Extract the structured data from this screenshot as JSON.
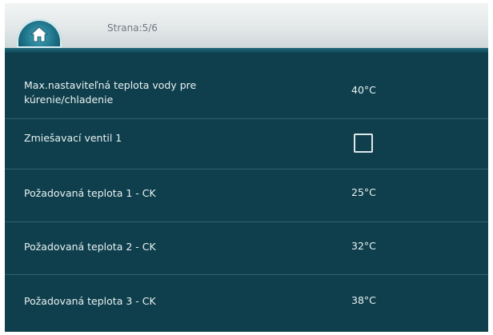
{
  "header": {
    "page_label": "Strana:5/6"
  },
  "settings": [
    {
      "label_line1": "Max.nastaviteľná teplota vody pre",
      "label_line2": "kúrenie/chladenie",
      "value": "40°C"
    },
    {
      "label_line1": "Zmiešavací ventil 1",
      "checked": false
    },
    {
      "label_line1": "Požadovaná teplota 1 - CK",
      "value": "25°C"
    },
    {
      "label_line1": "Požadovaná teplota 2 - CK",
      "value": "32°C"
    },
    {
      "label_line1": "Požadovaná teplota 3 - CK",
      "value": "38°C"
    }
  ],
  "icons": {
    "home": "home-icon",
    "checkbox": "checkbox-icon"
  }
}
